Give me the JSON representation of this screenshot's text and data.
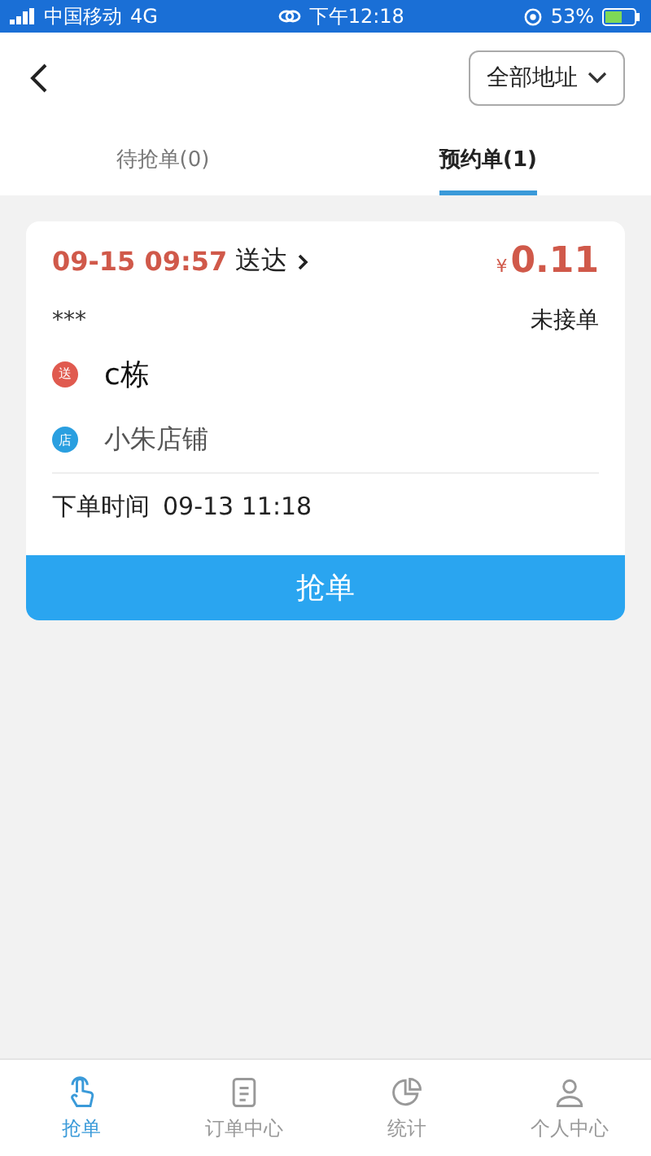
{
  "status_bar": {
    "carrier": "中国移动",
    "network": "4G",
    "time": "下午12:18",
    "battery": "53%"
  },
  "header": {
    "filter": "全部地址"
  },
  "tabs": [
    {
      "label": "待抢单(0)",
      "selected": false
    },
    {
      "label": "预约单(1)",
      "selected": true
    }
  ],
  "orders": [
    {
      "deliver_time": "09-15 09:57",
      "deliver_label": "送达",
      "currency": "¥",
      "price": "0.11",
      "customer": "***",
      "status": "未接单",
      "stops": [
        {
          "kind": "deliver",
          "badge": "送",
          "name": "c栋"
        },
        {
          "kind": "shop",
          "badge": "店",
          "name": "小朱店铺"
        }
      ],
      "order_time_label": "下单时间",
      "order_time": "09-13 11:18",
      "action": "抢单"
    }
  ],
  "bottom_nav": [
    {
      "kind": "grab",
      "label": "抢单",
      "selected": true
    },
    {
      "kind": "orders",
      "label": "订单中心",
      "selected": false
    },
    {
      "kind": "stats",
      "label": "统计",
      "selected": false
    },
    {
      "kind": "profile",
      "label": "个人中心",
      "selected": false
    }
  ]
}
